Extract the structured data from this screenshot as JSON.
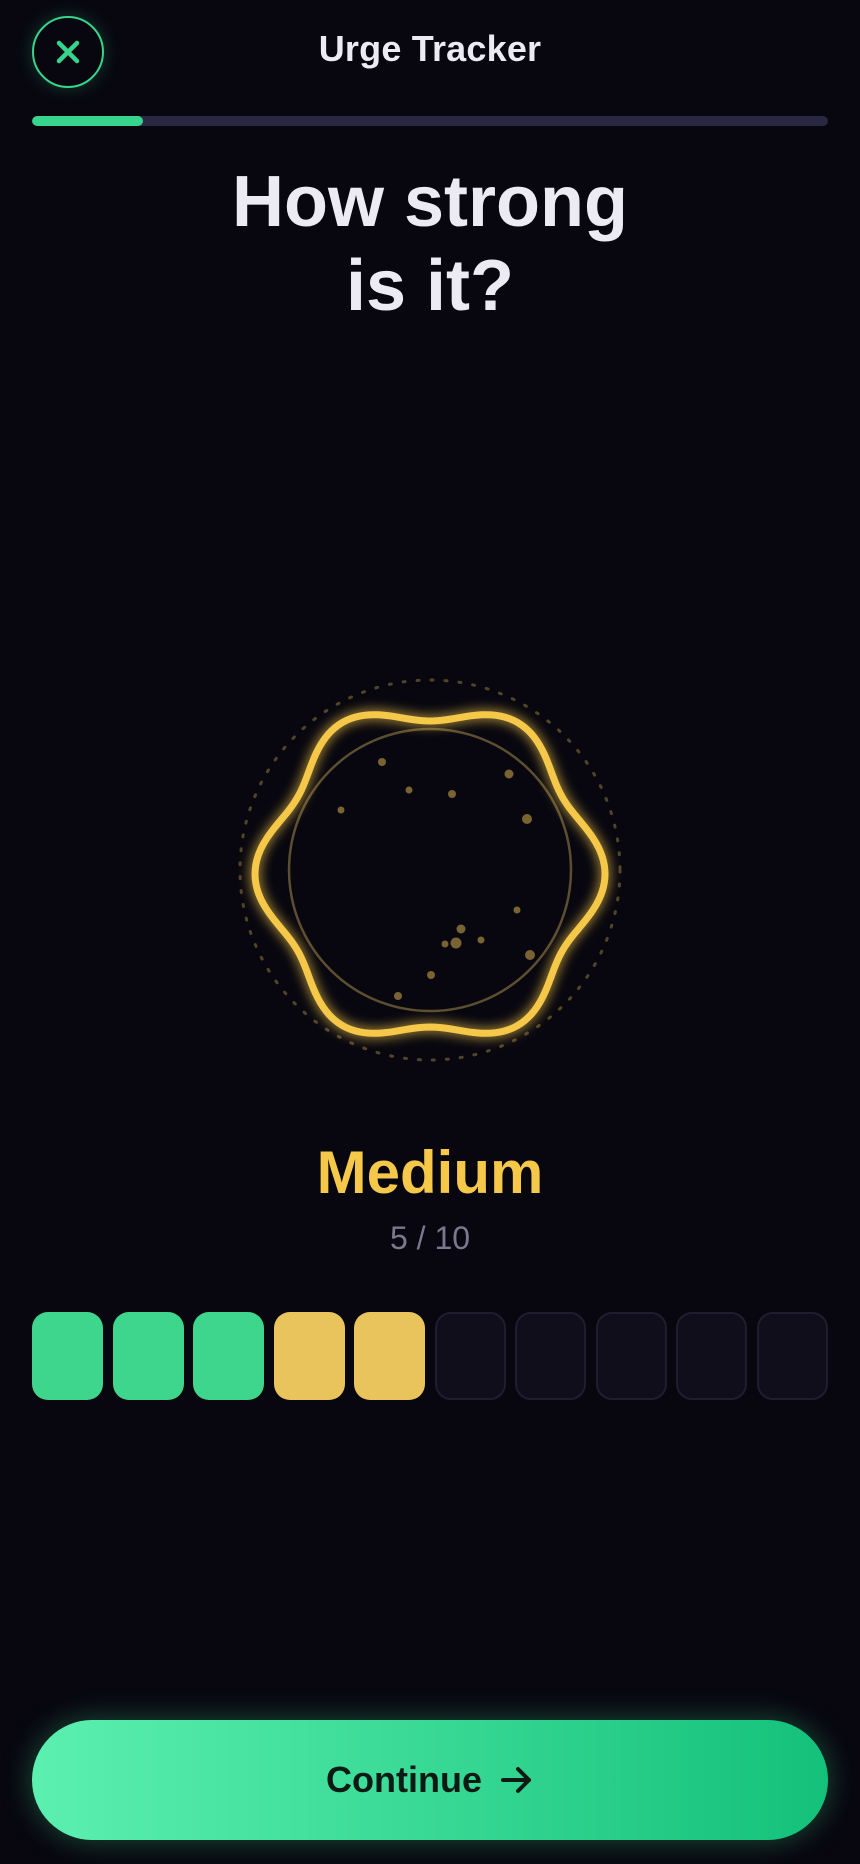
{
  "header": {
    "title": "Urge Tracker",
    "close_icon": "close-icon",
    "accent_color": "#36d48c"
  },
  "progress": {
    "fraction": 0.14
  },
  "question": {
    "line1": "How strong",
    "line2": "is it?"
  },
  "intensity": {
    "label": "Medium",
    "score": "5 / 10",
    "value": 5,
    "max": 10,
    "label_color": "#f5c84a",
    "orb_color": "#f5c84a"
  },
  "scale": {
    "cells": [
      {
        "level": 1,
        "state": "low"
      },
      {
        "level": 2,
        "state": "low"
      },
      {
        "level": 3,
        "state": "low"
      },
      {
        "level": 4,
        "state": "mid"
      },
      {
        "level": 5,
        "state": "mid"
      },
      {
        "level": 6,
        "state": "off"
      },
      {
        "level": 7,
        "state": "off"
      },
      {
        "level": 8,
        "state": "off"
      },
      {
        "level": 9,
        "state": "off"
      },
      {
        "level": 10,
        "state": "off"
      }
    ],
    "colors": {
      "low": "#3ed68c",
      "mid": "#e9c35c",
      "off": "#100e1b"
    }
  },
  "footer": {
    "continue_label": "Continue",
    "continue_icon": "arrow-right-icon"
  }
}
